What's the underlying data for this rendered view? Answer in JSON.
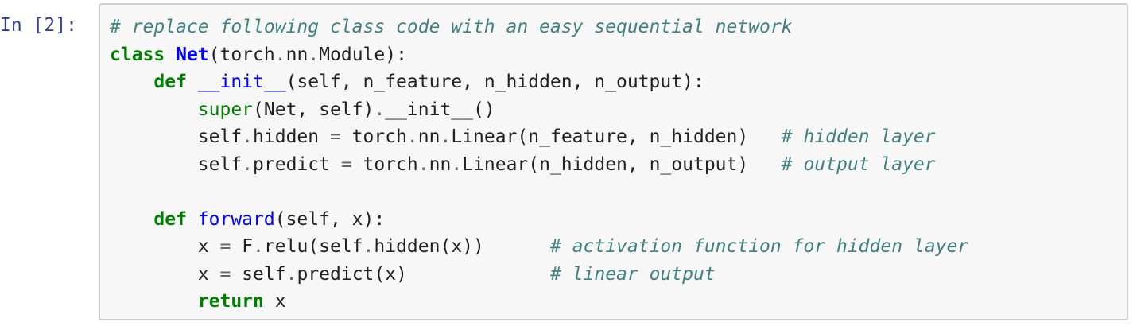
{
  "cell": {
    "prompt": "In [2]:",
    "lines": [
      [
        {
          "t": "# replace following class code with an easy sequential network",
          "c": "cm"
        }
      ],
      [
        {
          "t": "class",
          "c": "kw"
        },
        {
          "t": " ",
          "c": "n"
        },
        {
          "t": "Net",
          "c": "cls"
        },
        {
          "t": "(torch",
          "c": "n"
        },
        {
          "t": ".",
          "c": "op"
        },
        {
          "t": "nn",
          "c": "n"
        },
        {
          "t": ".",
          "c": "op"
        },
        {
          "t": "Module):",
          "c": "n"
        }
      ],
      [
        {
          "t": "    ",
          "c": "n"
        },
        {
          "t": "def",
          "c": "kw"
        },
        {
          "t": " ",
          "c": "n"
        },
        {
          "t": "__init__",
          "c": "fn"
        },
        {
          "t": "(self, n_feature, n_hidden, n_output):",
          "c": "n"
        }
      ],
      [
        {
          "t": "        ",
          "c": "n"
        },
        {
          "t": "super",
          "c": "bi"
        },
        {
          "t": "(Net, self)",
          "c": "n"
        },
        {
          "t": ".",
          "c": "op"
        },
        {
          "t": "__init__()",
          "c": "n"
        }
      ],
      [
        {
          "t": "        self",
          "c": "n"
        },
        {
          "t": ".",
          "c": "op"
        },
        {
          "t": "hidden ",
          "c": "n"
        },
        {
          "t": "=",
          "c": "op"
        },
        {
          "t": " torch",
          "c": "n"
        },
        {
          "t": ".",
          "c": "op"
        },
        {
          "t": "nn",
          "c": "n"
        },
        {
          "t": ".",
          "c": "op"
        },
        {
          "t": "Linear(n_feature, n_hidden)   ",
          "c": "n"
        },
        {
          "t": "# hidden layer",
          "c": "cm"
        }
      ],
      [
        {
          "t": "        self",
          "c": "n"
        },
        {
          "t": ".",
          "c": "op"
        },
        {
          "t": "predict ",
          "c": "n"
        },
        {
          "t": "=",
          "c": "op"
        },
        {
          "t": " torch",
          "c": "n"
        },
        {
          "t": ".",
          "c": "op"
        },
        {
          "t": "nn",
          "c": "n"
        },
        {
          "t": ".",
          "c": "op"
        },
        {
          "t": "Linear(n_hidden, n_output)   ",
          "c": "n"
        },
        {
          "t": "# output layer",
          "c": "cm"
        }
      ],
      [
        {
          "t": "",
          "c": "n"
        }
      ],
      [
        {
          "t": "    ",
          "c": "n"
        },
        {
          "t": "def",
          "c": "kw"
        },
        {
          "t": " ",
          "c": "n"
        },
        {
          "t": "forward",
          "c": "fn"
        },
        {
          "t": "(self, x):",
          "c": "n"
        }
      ],
      [
        {
          "t": "        x ",
          "c": "n"
        },
        {
          "t": "=",
          "c": "op"
        },
        {
          "t": " F",
          "c": "n"
        },
        {
          "t": ".",
          "c": "op"
        },
        {
          "t": "relu(self",
          "c": "n"
        },
        {
          "t": ".",
          "c": "op"
        },
        {
          "t": "hidden(x))      ",
          "c": "n"
        },
        {
          "t": "# activation function for hidden layer",
          "c": "cm"
        }
      ],
      [
        {
          "t": "        x ",
          "c": "n"
        },
        {
          "t": "=",
          "c": "op"
        },
        {
          "t": " self",
          "c": "n"
        },
        {
          "t": ".",
          "c": "op"
        },
        {
          "t": "predict(x)             ",
          "c": "n"
        },
        {
          "t": "# linear output",
          "c": "cm"
        }
      ],
      [
        {
          "t": "        ",
          "c": "n"
        },
        {
          "t": "return",
          "c": "kw"
        },
        {
          "t": " x",
          "c": "n"
        }
      ]
    ]
  }
}
